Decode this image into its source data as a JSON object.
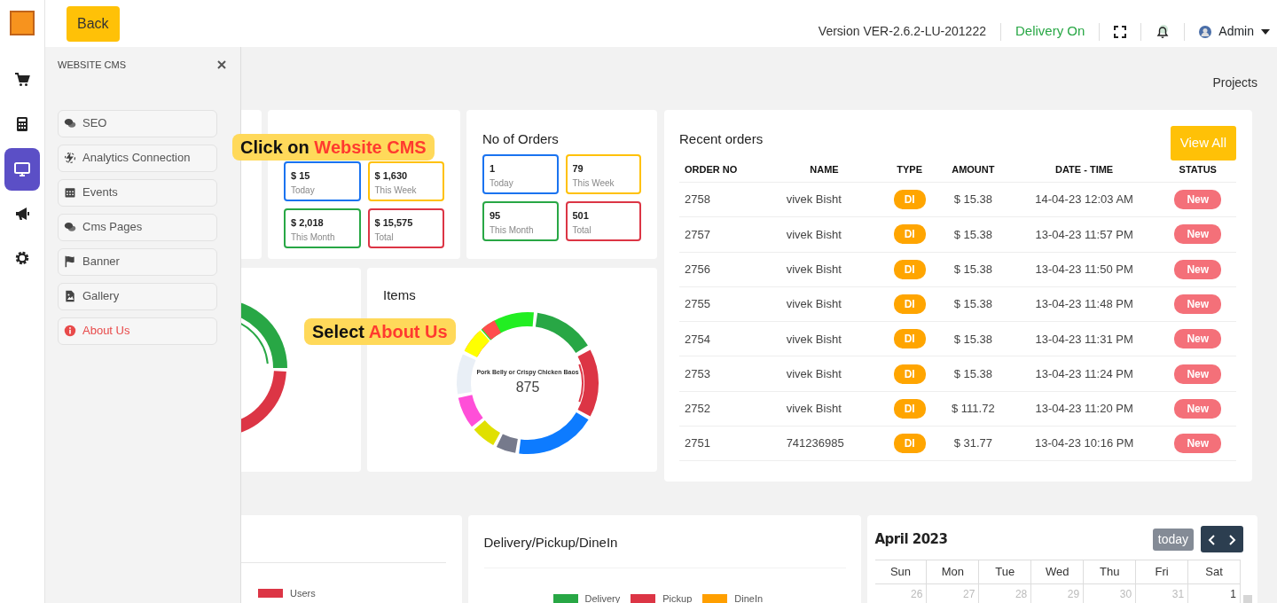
{
  "rail": [
    {
      "kind": "cart",
      "selected": false
    },
    {
      "kind": "calculator",
      "selected": false
    },
    {
      "kind": "monitor",
      "selected": true
    },
    {
      "kind": "megaphone",
      "selected": false
    },
    {
      "kind": "gear",
      "selected": false
    }
  ],
  "topbar": {
    "back": "Back",
    "version": "Version VER-2.6.2-LU-201222",
    "delivery": "Delivery On",
    "user": "Admin"
  },
  "breadcrumb": "Projects",
  "cms_panel": {
    "title": "WEBSITE CMS",
    "items": [
      {
        "label": "SEO",
        "kind": "comments",
        "selected": false
      },
      {
        "label": "Analytics Connection",
        "kind": "bolt",
        "selected": false
      },
      {
        "label": "Events",
        "kind": "calendar",
        "selected": false
      },
      {
        "label": "Cms Pages",
        "kind": "comments",
        "selected": false
      },
      {
        "label": "Banner",
        "kind": "flag",
        "selected": false
      },
      {
        "label": "Gallery",
        "kind": "file",
        "selected": false
      },
      {
        "label": "About Us",
        "kind": "info",
        "selected": true
      }
    ]
  },
  "hints": [
    {
      "text": "Click on",
      "highlight": "Website CMS"
    },
    {
      "text": "Select",
      "highlight": "About Us"
    }
  ],
  "sales": {
    "stats": [
      {
        "value": "$ 15",
        "label": "Today",
        "color": "#1a73f0"
      },
      {
        "value": "$ 1,630",
        "label": "This Week",
        "color": "#ffc107"
      },
      {
        "value": "$ 2,018",
        "label": "This Month",
        "color": "#28a745"
      },
      {
        "value": "$ 15,575",
        "label": "Total",
        "color": "#dc3545"
      }
    ]
  },
  "orders_count": {
    "title": "No of Orders",
    "stats": [
      {
        "value": "1",
        "label": "Today",
        "color": "#1a73f0"
      },
      {
        "value": "79",
        "label": "This Week",
        "color": "#ffc107"
      },
      {
        "value": "95",
        "label": "This Month",
        "color": "#28a745"
      },
      {
        "value": "501",
        "label": "Total",
        "color": "#dc3545"
      }
    ]
  },
  "items": {
    "title": "Items",
    "center_label": "Pork Belly or Crispy Chicken Baos",
    "center_value": "875"
  },
  "recent_orders": {
    "title": "Recent orders",
    "view_all": "View All",
    "columns": [
      "ORDER NO",
      "NAME",
      "TYPE",
      "AMOUNT",
      "DATE - TIME",
      "STATUS"
    ],
    "rows": [
      {
        "order_no": "2758",
        "name": "vivek Bisht",
        "type": "DI",
        "amount": "$ 15.38",
        "date_time": "14-04-23 12:03 AM",
        "status": "New"
      },
      {
        "order_no": "2757",
        "name": "vivek Bisht",
        "type": "DI",
        "amount": "$ 15.38",
        "date_time": "13-04-23 11:57 PM",
        "status": "New"
      },
      {
        "order_no": "2756",
        "name": "vivek Bisht",
        "type": "DI",
        "amount": "$ 15.38",
        "date_time": "13-04-23 11:50 PM",
        "status": "New"
      },
      {
        "order_no": "2755",
        "name": "vivek Bisht",
        "type": "DI",
        "amount": "$ 15.38",
        "date_time": "13-04-23 11:48 PM",
        "status": "New"
      },
      {
        "order_no": "2754",
        "name": "vivek Bisht",
        "type": "DI",
        "amount": "$ 15.38",
        "date_time": "13-04-23 11:31 PM",
        "status": "New"
      },
      {
        "order_no": "2753",
        "name": "vivek Bisht",
        "type": "DI",
        "amount": "$ 15.38",
        "date_time": "13-04-23 11:24 PM",
        "status": "New"
      },
      {
        "order_no": "2752",
        "name": "vivek Bisht",
        "type": "DI",
        "amount": "$ 111.72",
        "date_time": "13-04-23 11:20 PM",
        "status": "New"
      },
      {
        "order_no": "2751",
        "name": "741236985",
        "type": "DI",
        "amount": "$ 31.77",
        "date_time": "13-04-23 10:16 PM",
        "status": "New"
      }
    ]
  },
  "orders_users": {
    "legend": [
      {
        "label": "Users",
        "color": "#dc3545"
      }
    ]
  },
  "delivery_chart": {
    "title": "Delivery/Pickup/DineIn",
    "legend": [
      {
        "label": "Delivery",
        "color": "#28a745"
      },
      {
        "label": "Pickup",
        "color": "#dc3545"
      },
      {
        "label": "DineIn",
        "color": "#ff9f00"
      }
    ]
  },
  "calendar": {
    "title": "April 2023",
    "today": "today",
    "weekdays": [
      "Sun",
      "Mon",
      "Tue",
      "Wed",
      "Thu",
      "Fri",
      "Sat"
    ],
    "dates": [
      {
        "day": "26",
        "other_month": true
      },
      {
        "day": "27",
        "other_month": true
      },
      {
        "day": "28",
        "other_month": true
      },
      {
        "day": "29",
        "other_month": true
      },
      {
        "day": "30",
        "other_month": true
      },
      {
        "day": "31",
        "other_month": true
      },
      {
        "day": "1",
        "other_month": false
      }
    ]
  }
}
